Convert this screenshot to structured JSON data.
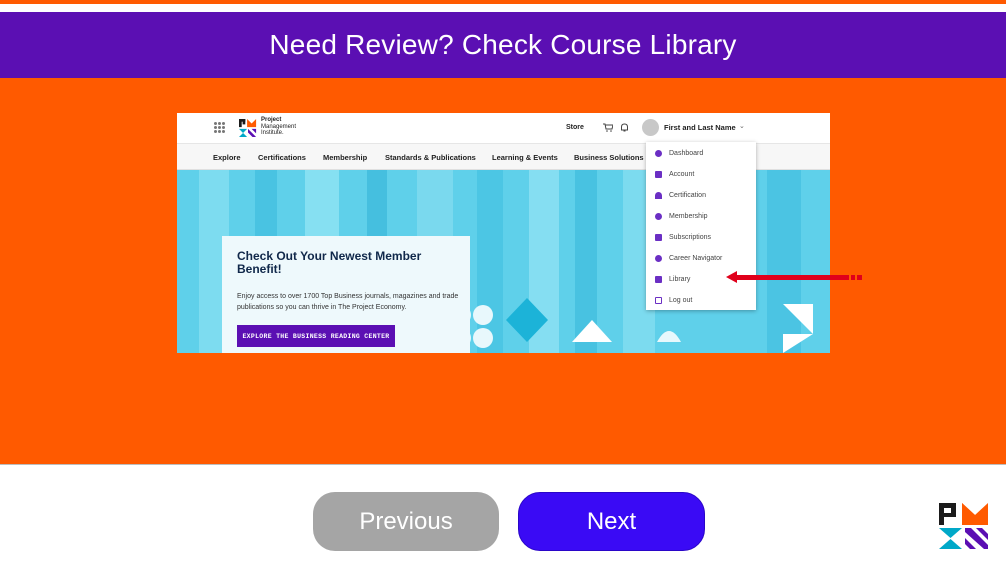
{
  "slide": {
    "title": "Need Review? Check Course Library"
  },
  "screenshot": {
    "header": {
      "brand_line1": "Project",
      "brand_line2": "Management",
      "brand_line3": "Institute.",
      "store_label": "Store",
      "user_name": "First and Last Name"
    },
    "nav": [
      "Explore",
      "Certifications",
      "Membership",
      "Standards & Publications",
      "Learning & Events",
      "Business Solutions"
    ],
    "hero": {
      "title": "Check Out Your Newest Member Benefit!",
      "body": "Enjoy access to over 1700 Top Business journals, magazines and trade publications so you can thrive in The Project Economy.",
      "button_label": "EXPLORE THE BUSINESS READING CENTER"
    },
    "dropdown": [
      {
        "label": "Dashboard",
        "icon": "dashboard-icon"
      },
      {
        "label": "Account",
        "icon": "person-icon"
      },
      {
        "label": "Certification",
        "icon": "ribbon-icon"
      },
      {
        "label": "Membership",
        "icon": "membership-icon"
      },
      {
        "label": "Subscriptions",
        "icon": "subscriptions-icon"
      },
      {
        "label": "Career Navigator",
        "icon": "compass-icon"
      },
      {
        "label": "Library",
        "icon": "book-icon"
      },
      {
        "label": "Log out",
        "icon": "logout-icon"
      }
    ]
  },
  "buttons": {
    "previous": "Previous",
    "next": "Next"
  },
  "colors": {
    "orange": "#ff5a00",
    "purple": "#5b0fb3",
    "next_blue": "#3a0af5",
    "prev_gray": "#a5a5a5",
    "arrow_red": "#e0001b",
    "hero_cyan": "#5fd0ea"
  }
}
